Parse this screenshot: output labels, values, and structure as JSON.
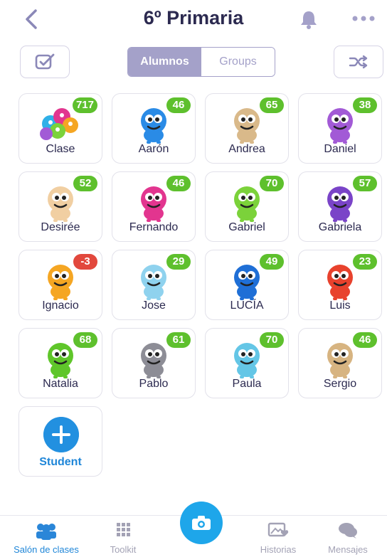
{
  "header": {
    "title": "6º Primaria"
  },
  "toolbar": {
    "tab_students": "Alumnos",
    "tab_groups": "Groups"
  },
  "colors": {
    "accent": "#a4a1c9",
    "points_positive": "#5ec02d",
    "points_negative": "#e2483d",
    "primary_blue": "#1f86d8"
  },
  "students": [
    {
      "name": "Clase",
      "points": "717",
      "avatar": "class-group",
      "color": "#e8a34f"
    },
    {
      "name": "Aarón",
      "points": "46",
      "avatar": "monster-blue-horn",
      "color": "#2a8be6"
    },
    {
      "name": "Andrea",
      "points": "65",
      "avatar": "monster-tan-glasses",
      "color": "#d9b98a"
    },
    {
      "name": "Daniel",
      "points": "38",
      "avatar": "monster-purple-beak",
      "color": "#a25ad6"
    },
    {
      "name": "Desirée",
      "points": "52",
      "avatar": "monster-beige-horns",
      "color": "#f1cfa2"
    },
    {
      "name": "Fernando",
      "points": "46",
      "avatar": "monster-pink",
      "color": "#e2358f"
    },
    {
      "name": "Gabriel",
      "points": "70",
      "avatar": "monster-green-cyclops",
      "color": "#7bd23a"
    },
    {
      "name": "Gabriela",
      "points": "57",
      "avatar": "monster-purple-cyclops",
      "color": "#7a44c8"
    },
    {
      "name": "Ignacio",
      "points": "-3",
      "avatar": "monster-orange-flame",
      "color": "#f5a623",
      "negative": true
    },
    {
      "name": "Jose",
      "points": "29",
      "avatar": "monster-light-blue-multi-eye",
      "color": "#8fd2ee"
    },
    {
      "name": "LUCÍA",
      "points": "49",
      "avatar": "monster-blue-cyclops",
      "color": "#1f6fd6"
    },
    {
      "name": "Luis",
      "points": "23",
      "avatar": "monster-red-furry",
      "color": "#e8422d"
    },
    {
      "name": "Natalia",
      "points": "68",
      "avatar": "monster-green-horns",
      "color": "#5fc62a"
    },
    {
      "name": "Pablo",
      "points": "61",
      "avatar": "monster-gray-cat",
      "color": "#8d8d96"
    },
    {
      "name": "Paula",
      "points": "70",
      "avatar": "monster-cyan-furry",
      "color": "#64c6e6"
    },
    {
      "name": "Sergio",
      "points": "46",
      "avatar": "monster-tan-glasses",
      "color": "#d7b481"
    }
  ],
  "add_student": {
    "label": "Student"
  },
  "nav": {
    "classroom": "Salón de clases",
    "toolkit": "Toolkit",
    "stories": "Historias",
    "messages": "Mensajes"
  }
}
